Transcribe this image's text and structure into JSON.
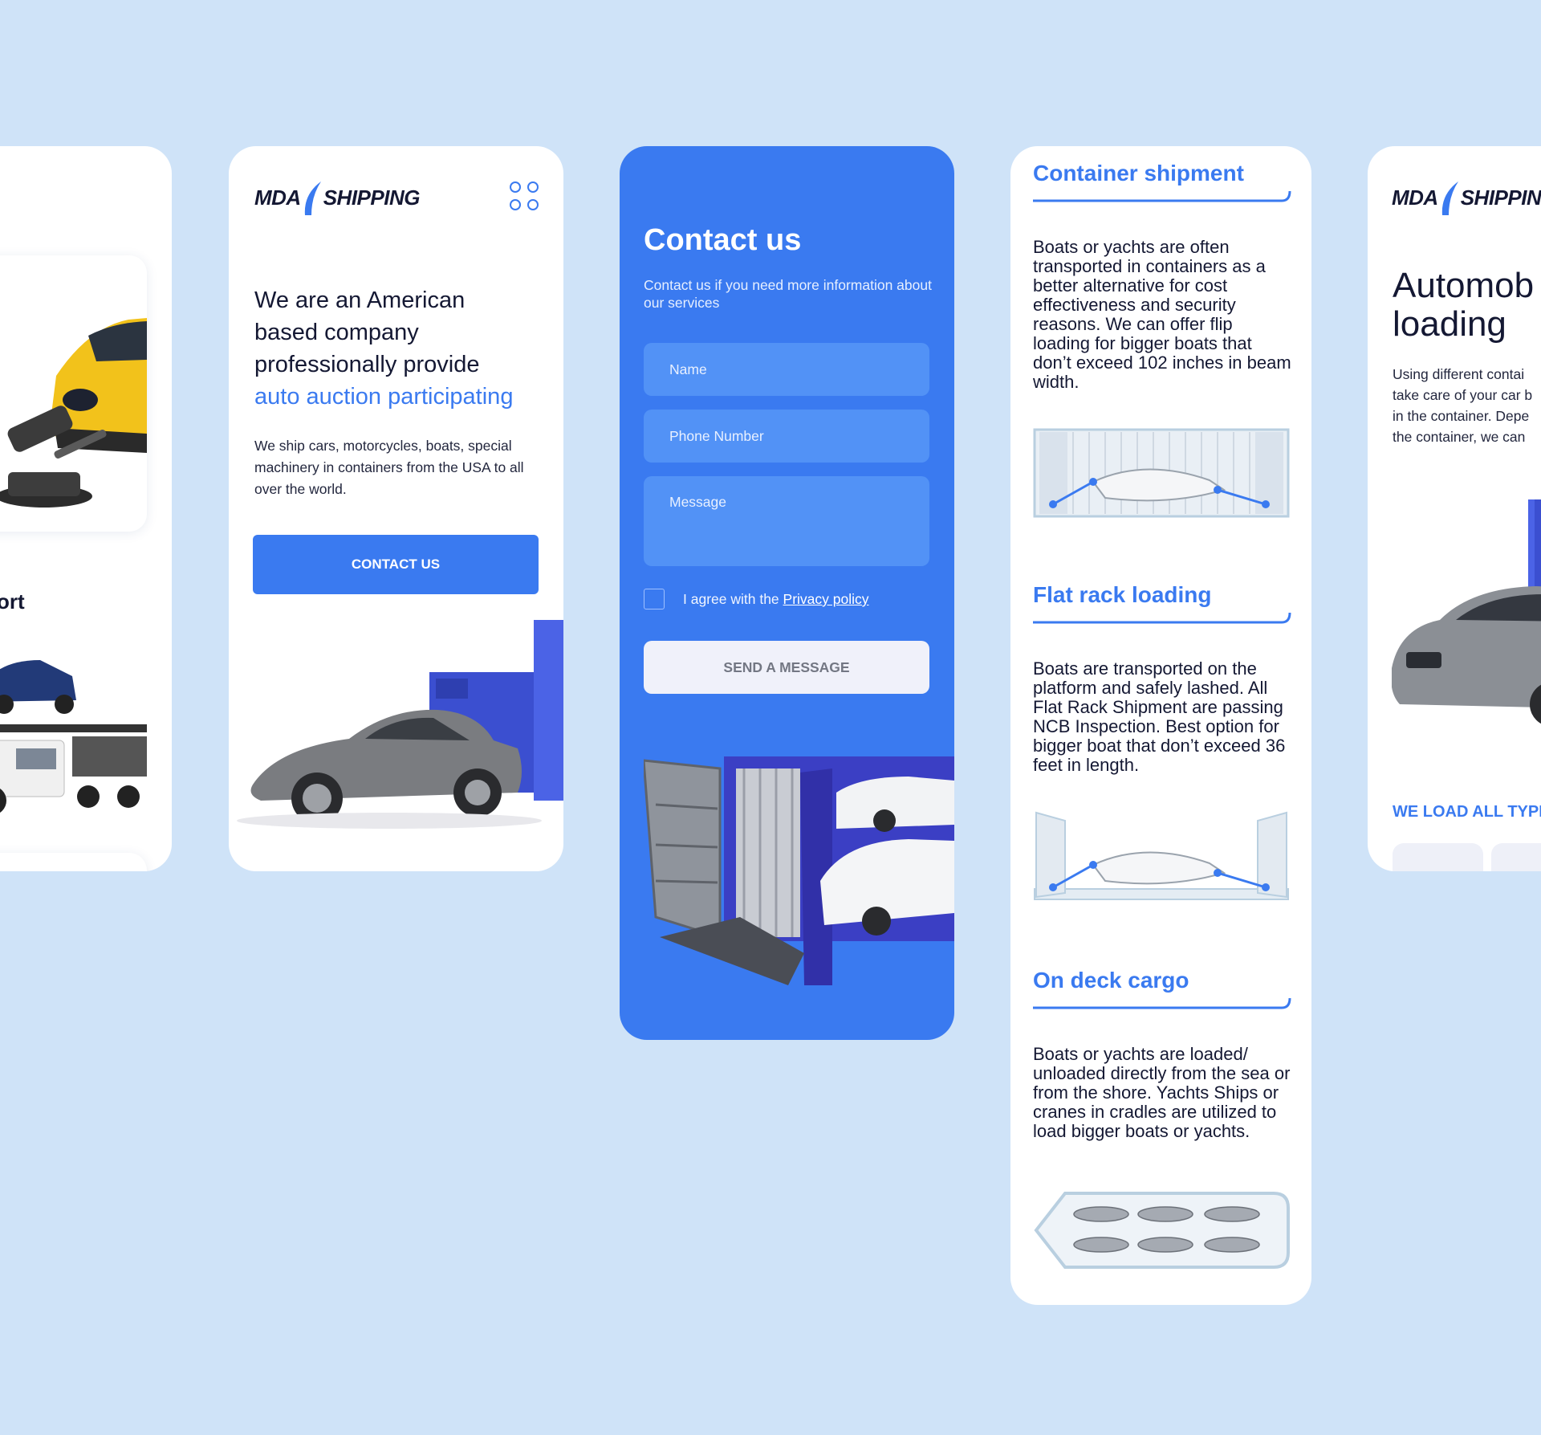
{
  "brand": {
    "logo_left": "MDA",
    "logo_right": "SHIPPING"
  },
  "card1": {
    "section_title_fragment": "ort"
  },
  "hero": {
    "title_line1": "We are an American",
    "title_line2": "based company",
    "title_line3": "professionally provide",
    "title_accent": "auto auction participating",
    "description": "We ship cars, motorcycles, boats, special machinery in containers from the USA to all over the world.",
    "cta_label": "CONTACT US"
  },
  "contact": {
    "title": "Contact us",
    "subtitle": "Contact us if you need more information about our services",
    "name_placeholder": "Name",
    "phone_placeholder": "Phone Number",
    "message_placeholder": "Message",
    "agree_text": "I agree with the",
    "privacy_link": "Privacy policy",
    "send_label": "SEND A MESSAGE"
  },
  "shipping": {
    "sections": [
      {
        "title": "Container shipment",
        "body": "Boats or yachts are often transported in containers as a better alternative for cost effectiveness and security reasons. We can offer flip loading for bigger boats that don’t exceed 102 inches in beam width."
      },
      {
        "title": "Flat rack loading",
        "body": "Boats are transported on the platform and safely lashed. All Flat Rack Shipment are passing NCB Inspection. Best option for bigger boat that don’t exceed 36 feet in length."
      },
      {
        "title": "On deck cargo",
        "body": "Boats or yachts are loaded/ unloaded directly from the sea or from the shore. Yachts Ships or cranes in cradles are utilized to load bigger boats or yachts."
      }
    ]
  },
  "automobile": {
    "title_line1": "Automob",
    "title_line2": "loading",
    "desc_line1": "Using different contai",
    "desc_line2": "take care of your car b",
    "desc_line3": "in the container. Depe",
    "desc_line4": "the container, we can",
    "link_label": "WE LOAD ALL TYPE"
  },
  "colors": {
    "accent": "#3a7af0",
    "background": "#cfe3f8",
    "dark_text": "#141833"
  }
}
